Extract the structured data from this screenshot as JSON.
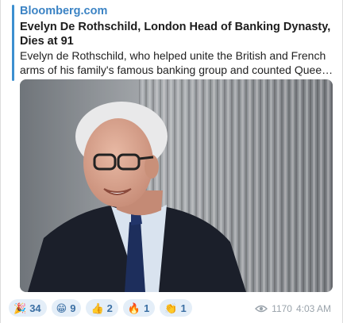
{
  "link_preview": {
    "site_name": "Bloomberg.com",
    "title": "Evelyn De Rothschild, London Head of Banking Dynasty, Dies at 91",
    "description": "Evelyn de Rothschild, who helped unite the British and French arms of his family's famous banking group and counted Queen El..."
  },
  "reactions": [
    {
      "icon": "party-popper-icon",
      "emoji": "🎉",
      "count": "34"
    },
    {
      "icon": "grinning-face-icon",
      "emoji": "😁",
      "count": "9"
    },
    {
      "icon": "thumbs-up-icon",
      "emoji": "👍",
      "count": "2"
    },
    {
      "icon": "fire-icon",
      "emoji": "🔥",
      "count": "1"
    },
    {
      "icon": "clapping-hands-icon",
      "emoji": "👏",
      "count": "1"
    }
  ],
  "meta": {
    "views": "1170",
    "time": "4:03 AM"
  },
  "colors": {
    "accent": "#3b83c4",
    "reaction_bg": "#e4eef8"
  }
}
